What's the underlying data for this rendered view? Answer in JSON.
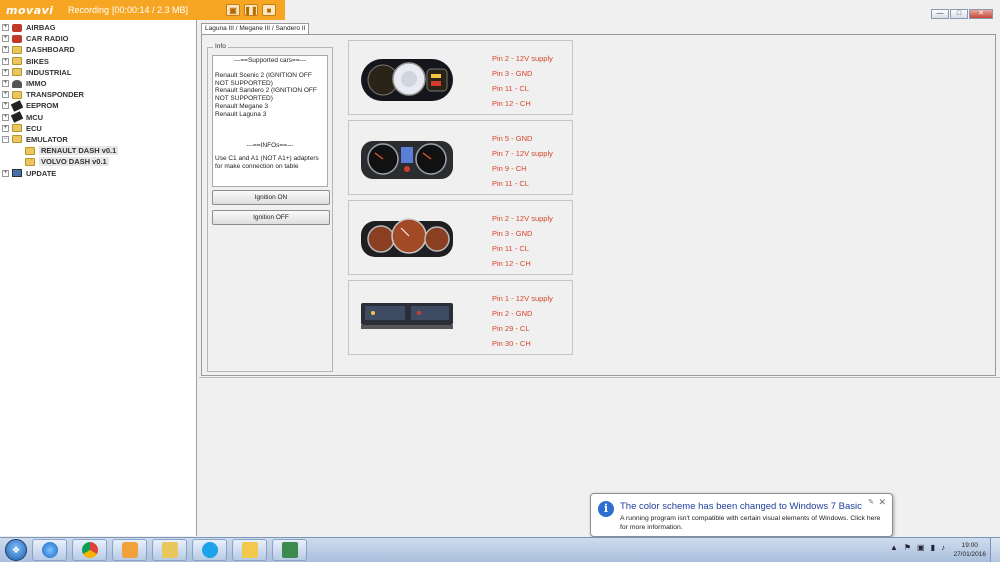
{
  "recorder": {
    "logo": "movavi",
    "status": "Recording",
    "time": "[00:00:14 / 2.3 MB]",
    "button_icons": [
      "camera-icon",
      "pause-icon",
      "stop-icon"
    ]
  },
  "window": {
    "controls": [
      "minimize",
      "maximize",
      "close"
    ]
  },
  "tree": {
    "items": [
      {
        "label": "AIRBAG",
        "icon": "airbag-icon"
      },
      {
        "label": "CAR RADIO",
        "icon": "radio-icon"
      },
      {
        "label": "DASHBOARD",
        "icon": "folder-icon"
      },
      {
        "label": "BIKES",
        "icon": "folder-icon"
      },
      {
        "label": "INDUSTRIAL",
        "icon": "folder-icon"
      },
      {
        "label": "IMMO",
        "icon": "person-icon"
      },
      {
        "label": "TRANSPONDER",
        "icon": "folder-icon"
      },
      {
        "label": "EEPROM",
        "icon": "chip-icon"
      },
      {
        "label": "MCU",
        "icon": "chip-icon"
      },
      {
        "label": "ECU",
        "icon": "folder-icon"
      },
      {
        "label": "EMULATOR",
        "icon": "folder-icon"
      }
    ],
    "emulator_children": [
      {
        "label": "RENAULT DASH v0.1"
      },
      {
        "label": "VOLVO DASH v0.1"
      }
    ],
    "update": {
      "label": "UPDATE",
      "icon": "monitor-icon"
    }
  },
  "tab": {
    "label": "Laguna III / Megane III / Sandero II"
  },
  "info": {
    "legend": "Info",
    "supported_header": "---==Supported cars==---",
    "supported_lines": [
      "Renault Scenic 2 (IGNITION OFF",
      "NOT SUPPORTED)",
      "Renault Sandero 2 (IGNITION OFF",
      "NOT SUPPORTED)",
      "Renault Megane 3",
      "Renault Laguna 3"
    ],
    "infos_header": "---==INFOs==---",
    "infos_lines": [
      "Use C1 and A1 (NOT A1+) adapters",
      "for make connection on table"
    ],
    "ignition_on": "Ignition ON",
    "ignition_off": "Ignition OFF"
  },
  "clusters": [
    {
      "pins": [
        "Pin 2 - 12V supply",
        "Pin 3 - GND",
        "Pin 11 - CL",
        "Pin 12 - CH"
      ]
    },
    {
      "pins": [
        "Pin 5 - GND",
        "Pin 7 - 12V supply",
        "Pin 9 - CH",
        "Pin 11 - CL"
      ]
    },
    {
      "pins": [
        "Pin 2 - 12V supply",
        "Pin 3 - GND",
        "Pin 11 - CL",
        "Pin 12 - CH"
      ]
    },
    {
      "pins": [
        "Pin  1 - 12V supply",
        "Pin 2 - GND",
        "Pin 29 - CL",
        "Pin 30 - CH"
      ]
    }
  ],
  "notification": {
    "title": "The color scheme has been changed to Windows 7 Basic",
    "message": "A running program isn't compatible with certain visual elements of Windows. Click here for more information."
  },
  "taskbar": {
    "apps": [
      "ie-icon",
      "chrome-icon",
      "media-player-icon",
      "file-explorer-icon",
      "skype-icon",
      "notes-icon",
      "picture-icon"
    ],
    "clock_time": "19:00",
    "clock_date": "27/01/2016"
  },
  "colors": {
    "recorder_bar": "#f6a623",
    "pin_text": "#d6452c",
    "notification_title": "#1f3f9b"
  }
}
